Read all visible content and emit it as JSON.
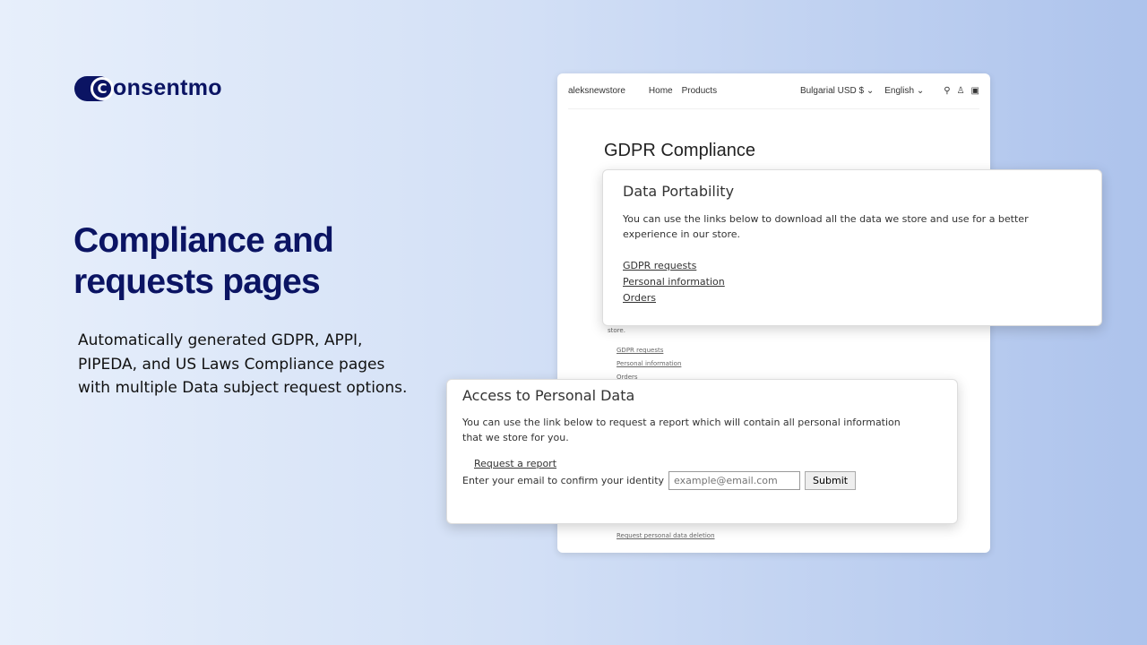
{
  "brand": {
    "logo_text": "Consentmo",
    "logo_mark": "C",
    "logo_word": "onsentmo"
  },
  "hero": {
    "title": "Compliance and requests pages",
    "description": "Automatically generated GDPR, APPI, PIPEDA, and US Laws Compliance pages with multiple Data subject request options."
  },
  "store": {
    "name": "aleksnewstore",
    "nav": [
      "Home",
      "Products"
    ],
    "currency": "Bulgarial USD $",
    "language": "English",
    "page_title": "GDPR Compliance",
    "bg_text": "store.",
    "bg_links": [
      "GDPR requests",
      "Personal information",
      "Orders"
    ],
    "bottom_link": "Request personal data deletion"
  },
  "portability": {
    "title": "Data Portability",
    "text": "You can use the links below to download all the data we store and use for a better experience in our store.",
    "links": [
      "GDPR requests",
      "Personal information",
      "Orders"
    ]
  },
  "access": {
    "title": "Access to Personal Data",
    "text": "You can use the link below to request a report which will contain all personal information that we store for you.",
    "link": "Request a report",
    "email_label": "Enter your email to confirm your identity",
    "email_placeholder": "example@email.com",
    "submit": "Submit"
  },
  "colors": {
    "brand": "#0b1463"
  }
}
